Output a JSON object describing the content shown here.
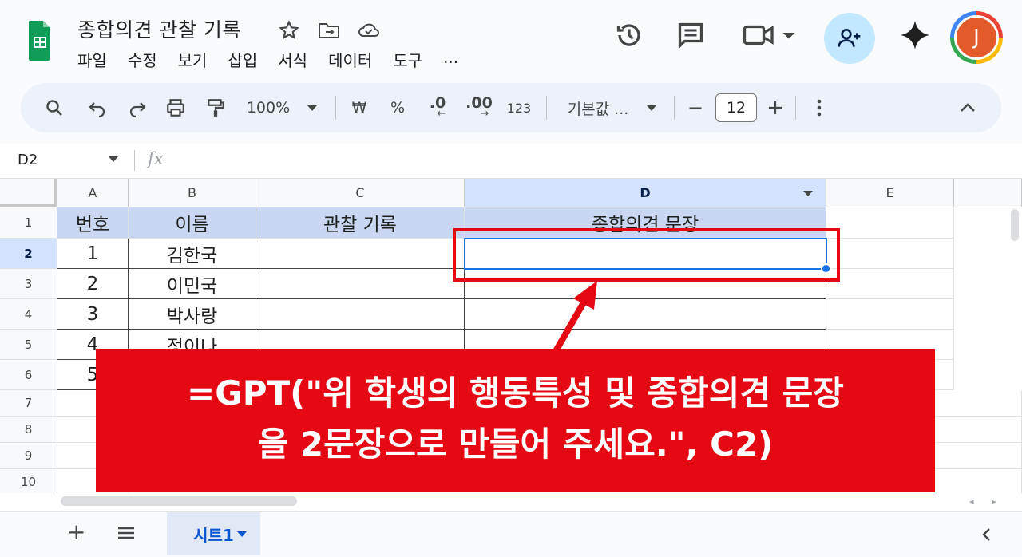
{
  "doc": {
    "title": "종합의견 관찰 기록",
    "menu": [
      "파일",
      "수정",
      "보기",
      "삽입",
      "서식",
      "데이터",
      "도구",
      "..."
    ],
    "avatar_initial": "J"
  },
  "toolbar": {
    "zoom": "100%",
    "currency": "₩",
    "percent": "%",
    "dec_decrease": ".0",
    "dec_increase": ".00",
    "number_format": "123",
    "font": "기본값 ...",
    "minus": "−",
    "font_size": "12",
    "plus": "+"
  },
  "formula_bar": {
    "name_box": "D2",
    "fx": "fx"
  },
  "grid": {
    "columns": [
      "A",
      "B",
      "C",
      "D",
      "E"
    ],
    "rows": [
      "1",
      "2",
      "3",
      "4",
      "5",
      "6",
      "7",
      "8",
      "9",
      "10"
    ],
    "header_row": [
      "번호",
      "이름",
      "관찰 기록",
      "종합의견 문장"
    ],
    "data": [
      {
        "no": "1",
        "name": "김한국"
      },
      {
        "no": "2",
        "name": "이민국"
      },
      {
        "no": "3",
        "name": "박사랑"
      },
      {
        "no": "4",
        "name": "정이나"
      },
      {
        "no": "5",
        "name": ""
      }
    ]
  },
  "annotation": {
    "line1": "=GPT(\"위 학생의 행동특성 및 종합의견 문장",
    "line2": "을 2문장으로 만들어 주세요.\", C2)"
  },
  "sheets": {
    "add": "+",
    "active_tab": "시트1"
  },
  "colors": {
    "accent_red": "#e50914",
    "selection_blue": "#1a73e8",
    "header_fill": "#c9d7f2"
  }
}
